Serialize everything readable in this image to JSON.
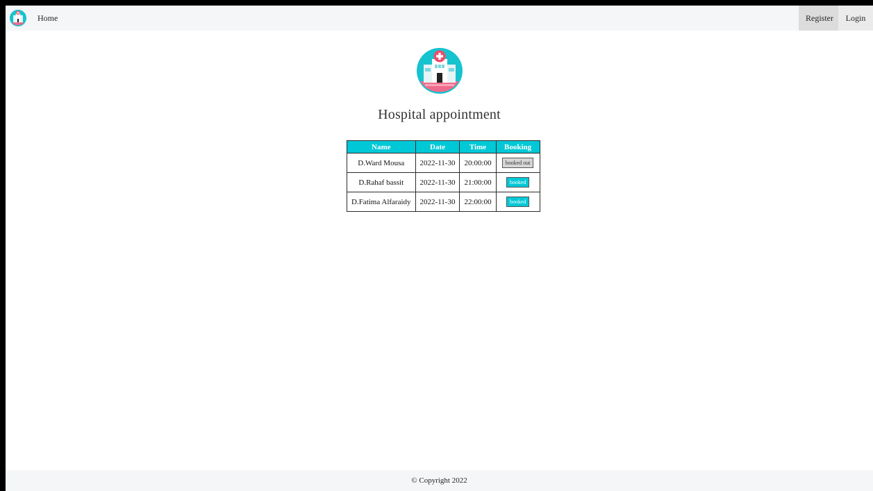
{
  "nav": {
    "logo_icon": "hospital-logo-icon",
    "home_label": "Home",
    "register_label": "Register",
    "login_label": "Login"
  },
  "hero": {
    "logo_icon": "hospital-building-icon",
    "title": "Hospital appointment"
  },
  "table": {
    "headers": [
      "Name",
      "Date",
      "Time",
      "Booking"
    ],
    "rows": [
      {
        "name": "D.Ward Mousa",
        "date": "2022-11-30",
        "time": "20:00:00",
        "booking": "booked out",
        "status": "out"
      },
      {
        "name": "D.Rahaf bassit",
        "date": "2022-11-30",
        "time": "21:00:00",
        "booking": "booked",
        "status": "available"
      },
      {
        "name": "D.Fatima Alfaraidy",
        "date": "2022-11-30",
        "time": "22:00:00",
        "booking": "booked",
        "status": "available"
      }
    ]
  },
  "footer": {
    "copyright": "© Copyright 2022"
  },
  "colors": {
    "accent": "#00c8d6",
    "booked_out": "#d6d6d6",
    "navbar": "#f5f6f7"
  }
}
